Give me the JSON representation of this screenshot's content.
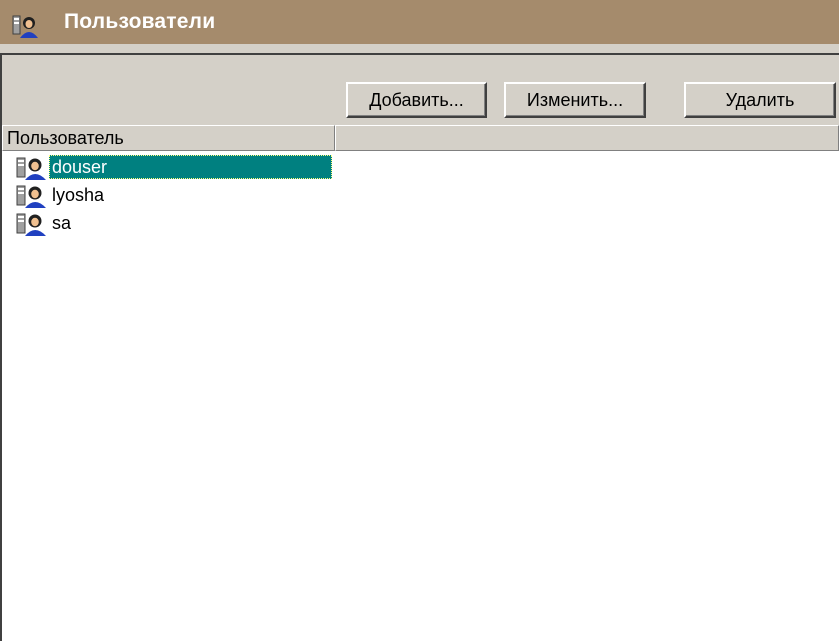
{
  "window": {
    "title": "Пользователи",
    "title_icon": "users-icon",
    "title_bar_color": "#a58b6c"
  },
  "toolbar": {
    "add_label": "Добавить...",
    "edit_label": "Изменить...",
    "delete_label": "Удалить"
  },
  "list": {
    "columns": [
      {
        "label": "Пользователь"
      },
      {
        "label": ""
      }
    ],
    "rows": [
      {
        "name": "douser",
        "icon": "user-icon",
        "selected": true
      },
      {
        "name": "lyosha",
        "icon": "user-icon",
        "selected": false
      },
      {
        "name": "sa",
        "icon": "user-icon",
        "selected": false
      }
    ],
    "selection_color": "#008080"
  }
}
